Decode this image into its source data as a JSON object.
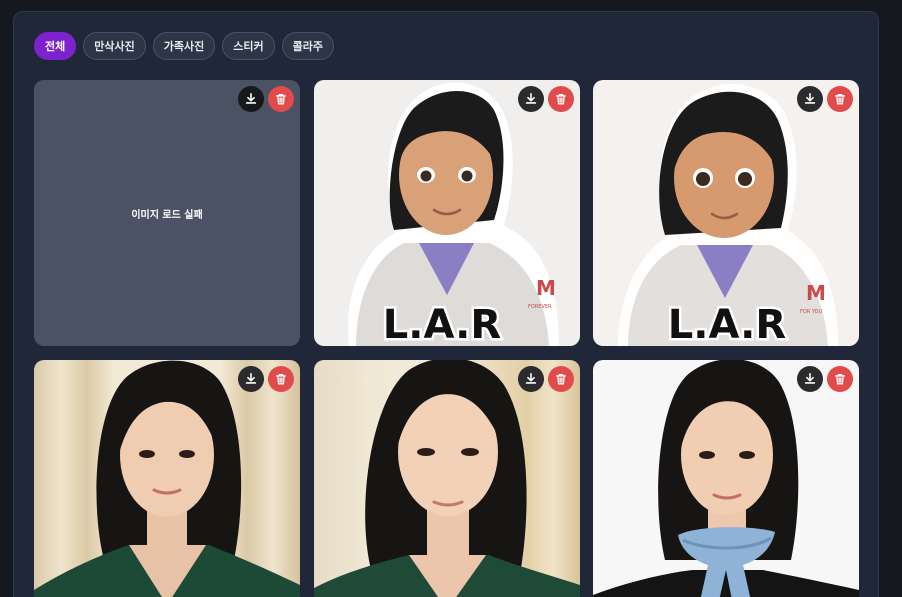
{
  "filters": {
    "tabs": [
      {
        "label": "전체",
        "active": true
      },
      {
        "label": "만삭사진",
        "active": false
      },
      {
        "label": "가족사진",
        "active": false
      },
      {
        "label": "스티커",
        "active": false
      },
      {
        "label": "콜라주",
        "active": false
      }
    ]
  },
  "gallery": {
    "items": [
      {
        "kind": "failed",
        "message": "이미지 로드 실패"
      },
      {
        "kind": "sticker",
        "caption": "L.A.R",
        "patch_letter": "M",
        "patch_text": "FOREVER"
      },
      {
        "kind": "sticker",
        "caption": "L.A.R",
        "patch_letter": "M",
        "patch_text": "FOR YOU"
      },
      {
        "kind": "portrait",
        "outfit": "green dress",
        "background": "cream curtain"
      },
      {
        "kind": "portrait",
        "outfit": "green dress",
        "background": "cream curtain"
      },
      {
        "kind": "portrait",
        "outfit": "blue scarf",
        "background": "white"
      }
    ],
    "action_icons": {
      "download": "download-icon",
      "delete": "trash-icon"
    }
  },
  "colors": {
    "accent": "#7e22ce",
    "delete": "#e24b4b",
    "panel": "#1f2738",
    "page": "#15181f"
  }
}
